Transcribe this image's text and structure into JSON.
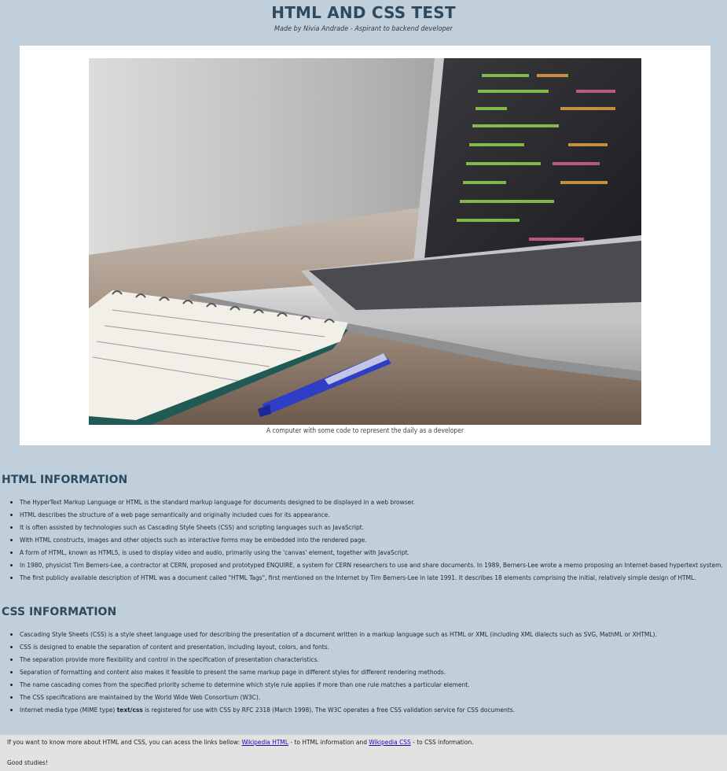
{
  "header": {
    "title": "HTML AND CSS TEST",
    "subtitle": "Made by Nivia Andrade - Aspirant to backend developer"
  },
  "figure": {
    "image_name": "laptop-notebook-pen-photo",
    "caption": "A computer with some code to represent the daily as a developer"
  },
  "html_section": {
    "heading": "HTML INFORMATION",
    "items": [
      "The HyperText Markup Language or HTML is the standard markup language for documents designed to be displayed in a web browser.",
      "HTML describes the structure of a web page semantically and originally included cues for its appearance.",
      "It is often assisted by technologies such as Cascading Style Sheets (CSS) and scripting languages such as JavaScript.",
      "With HTML constructs, images and other objects such as interactive forms may be embedded into the rendered page.",
      "A form of HTML, known as HTML5, is used to display video and audio, primarily using the 'canvas' element, together with JavaScript.",
      "In 1980, physicist Tim Berners-Lee, a contractor at CERN, proposed and prototyped ENQUIRE, a system for CERN researchers to use and share documents. In 1989, Berners-Lee wrote a memo proposing an Internet-based hypertext system.",
      "The first publicly available description of HTML was a document called \"HTML Tags\", first mentioned on the Internet by Tim Berners-Lee in late 1991. It describes 18 elements comprising the initial, relatively simple design of HTML."
    ]
  },
  "css_section": {
    "heading": "CSS INFORMATION",
    "items": [
      "Cascading Style Sheets (CSS) is a style sheet language used for describing the presentation of a document written in a markup language such as HTML or XML (including XML dialects such as SVG, MathML or XHTML).",
      "CSS is designed to enable the separation of content and presentation, including layout, colors, and fonts.",
      "The separation provide more flexibility and control in the specification of presentation characteristics.",
      "Separation of formatting and content also makes it feasible to present the same markup page in different styles for different rendering methods.",
      "The name cascading comes from the specified priority scheme to determine which style rule applies if more than one rule matches a particular element.",
      "The CSS specifications are maintained by the World Wide Web Consortium (W3C)."
    ],
    "last_item": {
      "pre": "Internet media type (MIME type) ",
      "code": "text/css",
      "post": " is registered for use with CSS by RFC 2318 (March 1998). The W3C operates a free CSS validation service for CSS documents."
    }
  },
  "footer": {
    "line1_pre": "If you want to know more about HTML and CSS, you can acess the links bellow: ",
    "link_html": "Wikipedia HTML",
    "line1_mid": " - to HTML information and ",
    "link_css": "Wikipedia CSS",
    "line1_post": " - to CSS information.",
    "line2": "Good studies!"
  },
  "colors": {
    "background": "#c1cfda",
    "heading": "#2f4a5e",
    "footer_bg": "#e2e2e2",
    "link": "#1a0dab"
  }
}
